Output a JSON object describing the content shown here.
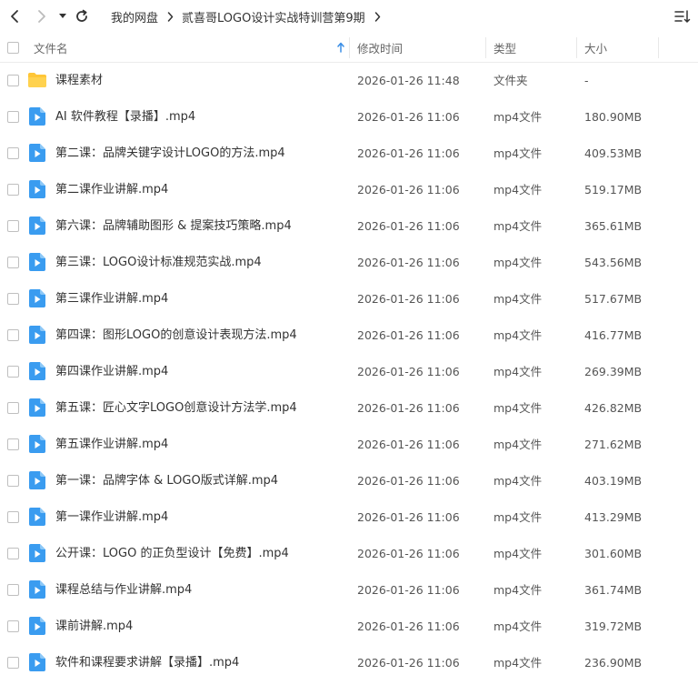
{
  "breadcrumb": {
    "items": [
      "我的网盘",
      "贰喜哥LOGO设计实战特训营第9期"
    ]
  },
  "icons": {
    "back": "chevron-left-icon",
    "forward": "chevron-right-icon",
    "history": "caret-down-icon",
    "refresh": "refresh-icon",
    "sort": "sort-list-icon",
    "folder": "folder-icon",
    "video": "video-file-icon"
  },
  "colors": {
    "folder": "#FFC637",
    "video": "#3A9CF0",
    "nav_active": "#333333",
    "nav_disabled": "#BBBBBB",
    "sort_arrow": "#3A8EE6"
  },
  "header": {
    "name": "文件名",
    "mtime": "修改时间",
    "type": "类型",
    "size": "大小"
  },
  "files": [
    {
      "kind": "folder",
      "name": "课程素材",
      "mtime": "2026-01-26 11:48",
      "type": "文件夹",
      "size": "-"
    },
    {
      "kind": "video",
      "name": "AI 软件教程【录播】.mp4",
      "mtime": "2026-01-26 11:06",
      "type": "mp4文件",
      "size": "180.90MB"
    },
    {
      "kind": "video",
      "name": "第二课：品牌关键字设计LOGO的方法.mp4",
      "mtime": "2026-01-26 11:06",
      "type": "mp4文件",
      "size": "409.53MB"
    },
    {
      "kind": "video",
      "name": "第二课作业讲解.mp4",
      "mtime": "2026-01-26 11:06",
      "type": "mp4文件",
      "size": "519.17MB"
    },
    {
      "kind": "video",
      "name": "第六课：品牌辅助图形 & 提案技巧策略.mp4",
      "mtime": "2026-01-26 11:06",
      "type": "mp4文件",
      "size": "365.61MB"
    },
    {
      "kind": "video",
      "name": "第三课：LOGO设计标准规范实战.mp4",
      "mtime": "2026-01-26 11:06",
      "type": "mp4文件",
      "size": "543.56MB"
    },
    {
      "kind": "video",
      "name": "第三课作业讲解.mp4",
      "mtime": "2026-01-26 11:06",
      "type": "mp4文件",
      "size": "517.67MB"
    },
    {
      "kind": "video",
      "name": "第四课：图形LOGO的创意设计表现方法.mp4",
      "mtime": "2026-01-26 11:06",
      "type": "mp4文件",
      "size": "416.77MB"
    },
    {
      "kind": "video",
      "name": "第四课作业讲解.mp4",
      "mtime": "2026-01-26 11:06",
      "type": "mp4文件",
      "size": "269.39MB"
    },
    {
      "kind": "video",
      "name": "第五课：匠心文字LOGO创意设计方法学.mp4",
      "mtime": "2026-01-26 11:06",
      "type": "mp4文件",
      "size": "426.82MB"
    },
    {
      "kind": "video",
      "name": "第五课作业讲解.mp4",
      "mtime": "2026-01-26 11:06",
      "type": "mp4文件",
      "size": "271.62MB"
    },
    {
      "kind": "video",
      "name": "第一课：品牌字体 & LOGO版式详解.mp4",
      "mtime": "2026-01-26 11:06",
      "type": "mp4文件",
      "size": "403.19MB"
    },
    {
      "kind": "video",
      "name": "第一课作业讲解.mp4",
      "mtime": "2026-01-26 11:06",
      "type": "mp4文件",
      "size": "413.29MB"
    },
    {
      "kind": "video",
      "name": "公开课：LOGO 的正负型设计【免费】.mp4",
      "mtime": "2026-01-26 11:06",
      "type": "mp4文件",
      "size": "301.60MB"
    },
    {
      "kind": "video",
      "name": "课程总结与作业讲解.mp4",
      "mtime": "2026-01-26 11:06",
      "type": "mp4文件",
      "size": "361.74MB"
    },
    {
      "kind": "video",
      "name": "课前讲解.mp4",
      "mtime": "2026-01-26 11:06",
      "type": "mp4文件",
      "size": "319.72MB"
    },
    {
      "kind": "video",
      "name": "软件和课程要求讲解【录播】.mp4",
      "mtime": "2026-01-26 11:06",
      "type": "mp4文件",
      "size": "236.90MB"
    }
  ]
}
